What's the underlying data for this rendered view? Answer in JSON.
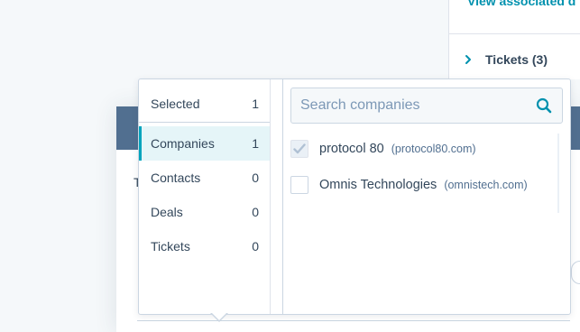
{
  "background": {
    "right_link": "View associated d",
    "tickets_row": {
      "label": "Tickets (3)"
    },
    "modal_peek_text": "T"
  },
  "popover": {
    "categories": [
      {
        "label": "Selected",
        "count": "1"
      },
      {
        "label": "Companies",
        "count": "1"
      },
      {
        "label": "Contacts",
        "count": "0"
      },
      {
        "label": "Deals",
        "count": "0"
      },
      {
        "label": "Tickets",
        "count": "0"
      }
    ],
    "active_category": "Companies",
    "search": {
      "placeholder": "Search companies",
      "value": ""
    },
    "results": [
      {
        "name": "protocol 80",
        "domain": "(protocol80.com)",
        "checked": true
      },
      {
        "name": "Omnis Technologies",
        "domain": "(omnistech.com)",
        "checked": false
      }
    ]
  },
  "colors": {
    "accent": "#00a4bd",
    "link": "#0091ae",
    "header": "#516f90",
    "text": "#33475b"
  }
}
